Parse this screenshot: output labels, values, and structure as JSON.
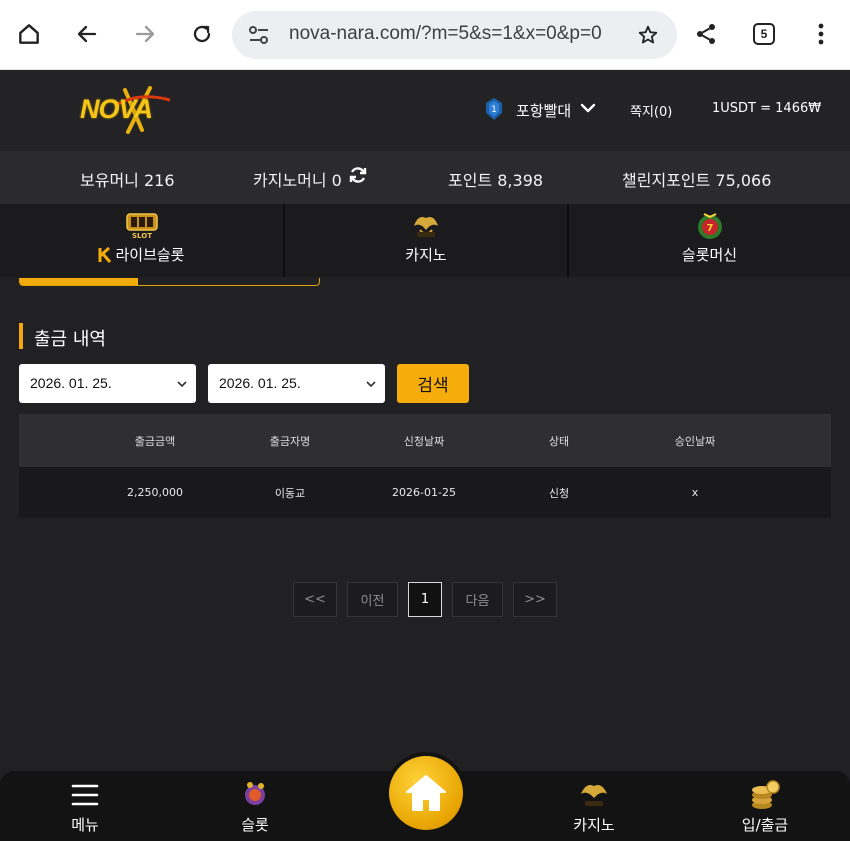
{
  "browser": {
    "url": "nova-nara.com/?m=5&s=1&x=0&p=0",
    "tab_count": "5"
  },
  "header": {
    "logo_text": "NOVA",
    "username": "포항빨대",
    "memo": "쪽지(0)",
    "rate": "1USDT = 1466₩"
  },
  "balances": {
    "holding": "보유머니 216",
    "casino": "카지노머니 0",
    "points": "포인트 8,398",
    "challenge": "챌린지포인트 75,066"
  },
  "categories": [
    {
      "label": "라이브슬롯",
      "icon": "live-slot-icon"
    },
    {
      "label": "카지노",
      "icon": "casino-crown-icon"
    },
    {
      "label": "슬롯머신",
      "icon": "slot-machine-icon"
    }
  ],
  "section": {
    "title": "출금 내역",
    "date_from": "2026. 01. 25.",
    "date_to": "2026. 01. 25.",
    "search_label": "검색"
  },
  "table": {
    "headers": [
      "출금금액",
      "출금자명",
      "신청날짜",
      "상태",
      "승인날짜"
    ],
    "rows": [
      [
        "2,250,000",
        "이동교",
        "2026-01-25",
        "신청",
        "x"
      ]
    ]
  },
  "pagination": {
    "first": "<<",
    "prev": "이전",
    "current": "1",
    "next": "다음",
    "last": ">>"
  },
  "bottom_nav": [
    {
      "label": "메뉴",
      "icon": "hamburger-icon"
    },
    {
      "label": "슬롯",
      "icon": "slot-icon"
    },
    {
      "label": "",
      "icon": "home-icon"
    },
    {
      "label": "카지노",
      "icon": "casino-icon"
    },
    {
      "label": "입/출금",
      "icon": "coins-icon"
    }
  ],
  "colors": {
    "accent": "#f6ad0b",
    "background": "#212124"
  }
}
